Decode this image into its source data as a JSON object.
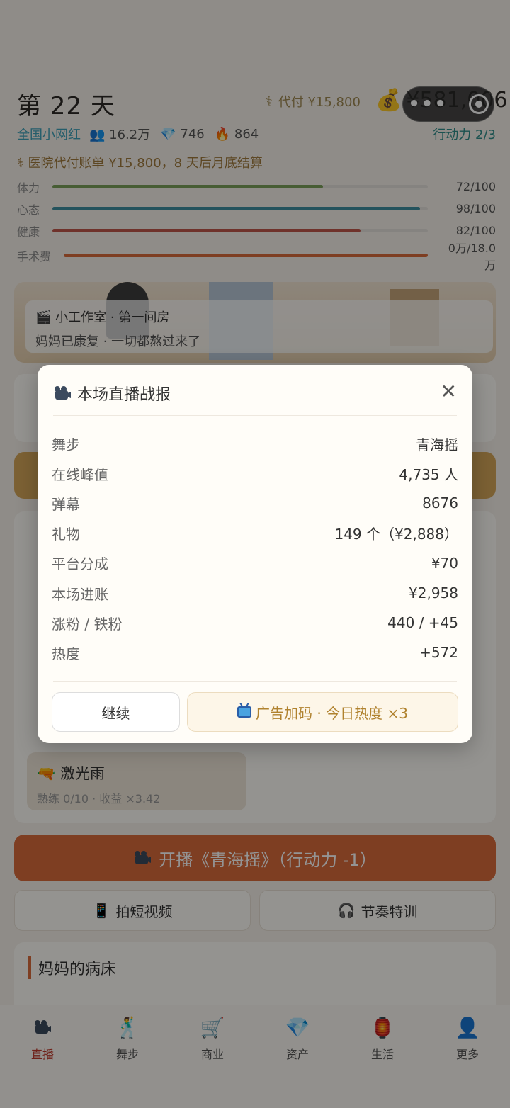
{
  "header": {
    "day": "第 22 天",
    "advance_label": "代付 ¥15,800",
    "money": "¥581,006",
    "rank": "全国小网红",
    "followers": "16.2万",
    "diamonds": "746",
    "heat": "864",
    "action_points": "行动力 2/3",
    "bill": "医院代付账单 ¥15,800，8 天后月底结算"
  },
  "bars": [
    {
      "label": "体力",
      "value": "72/100",
      "pct": 0.72,
      "color": "#7aa05a"
    },
    {
      "label": "心态",
      "value": "98/100",
      "pct": 0.98,
      "color": "#3e8fa0"
    },
    {
      "label": "健康",
      "value": "82/100",
      "pct": 0.82,
      "color": "#c0564b"
    },
    {
      "label": "手术费",
      "value": "0万/18.0万",
      "pct": 1.0,
      "color": "#d96b3c"
    }
  ],
  "banner": {
    "title": "小工作室 · 第一间房",
    "subtitle": "妈妈已康复 · 一切都熬过来了"
  },
  "dance_card": {
    "name": "激光雨",
    "detail": "熟练 0/10 · 收益 ×3.42"
  },
  "go_live": "开播《青海摇》（行动力 -1）",
  "short_video": "拍短视频",
  "rhythm_training": "节奏特训",
  "bed_title": "妈妈的病床",
  "tabs": [
    {
      "label": "直播",
      "icon": "camera-icon"
    },
    {
      "label": "舞步",
      "icon": "dancer-icon"
    },
    {
      "label": "商业",
      "icon": "cart-icon"
    },
    {
      "label": "资产",
      "icon": "diamond-icon"
    },
    {
      "label": "生活",
      "icon": "lantern-icon"
    },
    {
      "label": "更多",
      "icon": "person-icon"
    }
  ],
  "modal": {
    "title": "本场直播战报",
    "rows": [
      {
        "k": "舞步",
        "v": "青海摇"
      },
      {
        "k": "在线峰值",
        "v": "4,735 人"
      },
      {
        "k": "弹幕",
        "v": "8676"
      },
      {
        "k": "礼物",
        "v": "149 个（¥2,888）"
      },
      {
        "k": "平台分成",
        "v": "¥70"
      },
      {
        "k": "本场进账",
        "v": "¥2,958"
      },
      {
        "k": "涨粉 / 铁粉",
        "v": "440 / +45"
      },
      {
        "k": "热度",
        "v": "+572"
      }
    ],
    "continue_label": "继续",
    "ad_label": "广告加码 · 今日热度 ×3"
  }
}
